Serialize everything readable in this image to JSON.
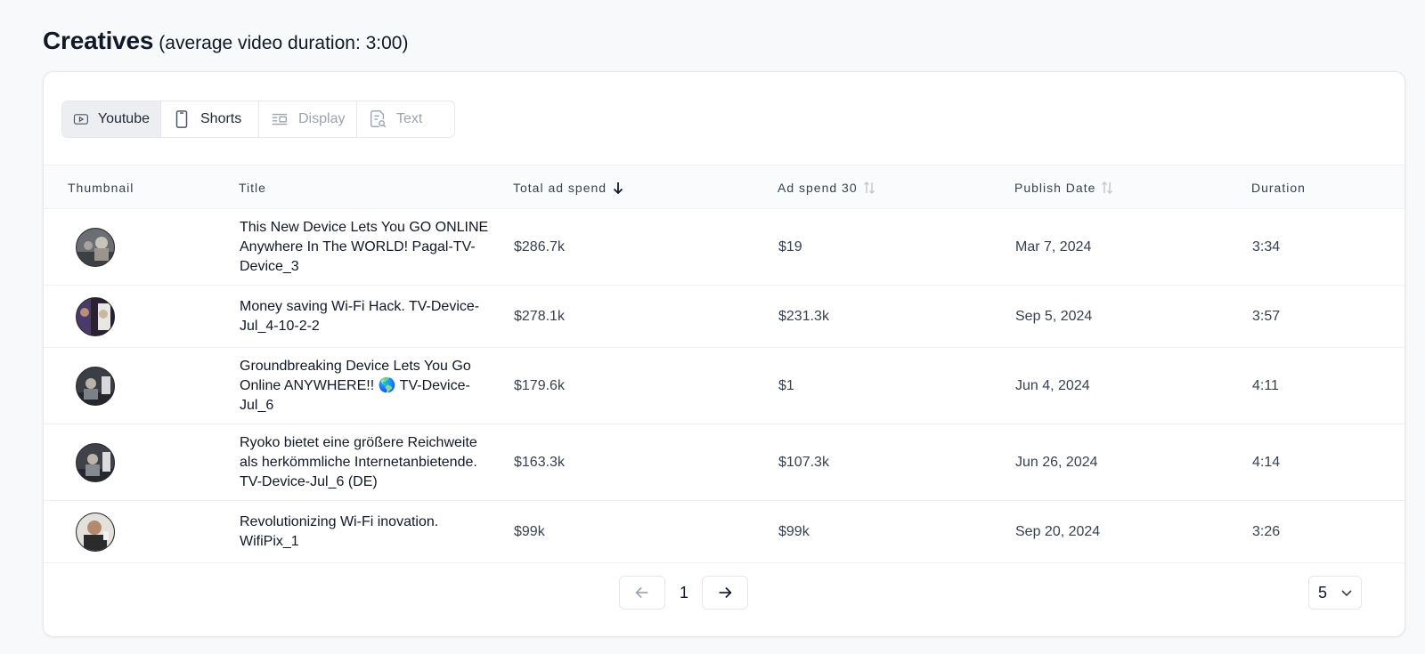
{
  "header": {
    "title": "Creatives",
    "subtitle": "(average video duration: 3:00)"
  },
  "tabs": [
    {
      "label": "Youtube",
      "icon": "youtube-icon",
      "state": "active"
    },
    {
      "label": "Shorts",
      "icon": "phone-icon",
      "state": "enabled"
    },
    {
      "label": "Display",
      "icon": "display-icon",
      "state": "disabled"
    },
    {
      "label": "Text",
      "icon": "text-search-icon",
      "state": "disabled"
    }
  ],
  "table": {
    "columns": {
      "thumbnail": "Thumbnail",
      "title": "Title",
      "total_ad_spend": "Total ad spend",
      "ad_spend_30": "Ad spend 30",
      "publish_date": "Publish Date",
      "duration": "Duration"
    },
    "sort": {
      "column": "total_ad_spend",
      "direction": "desc"
    },
    "rows": [
      {
        "title": "This New Device Lets You GO ONLINE Anywhere In The WORLD! Pagal-TV-Device_3",
        "total_ad_spend": "$286.7k",
        "ad_spend_30": "$19",
        "publish_date": "Mar 7, 2024",
        "duration": "3:34"
      },
      {
        "title": "Money saving Wi-Fi Hack. TV-Device-Jul_4-10-2-2",
        "total_ad_spend": "$278.1k",
        "ad_spend_30": "$231.3k",
        "publish_date": "Sep 5, 2024",
        "duration": "3:57"
      },
      {
        "title": "Groundbreaking Device Lets You Go Online ANYWHERE!! 🌎 TV-Device-Jul_6",
        "total_ad_spend": "$179.6k",
        "ad_spend_30": "$1",
        "publish_date": "Jun 4, 2024",
        "duration": "4:11"
      },
      {
        "title": "Ryoko bietet eine größere Reichweite als herkömmliche Internetanbietende. TV-Device-Jul_6 (DE)",
        "total_ad_spend": "$163.3k",
        "ad_spend_30": "$107.3k",
        "publish_date": "Jun 26, 2024",
        "duration": "4:14"
      },
      {
        "title": "Revolutionizing Wi-Fi inovation. WifiPix_1",
        "total_ad_spend": "$99k",
        "ad_spend_30": "$99k",
        "publish_date": "Sep 20, 2024",
        "duration": "3:26"
      }
    ]
  },
  "pagination": {
    "current_page": "1",
    "page_size": "5"
  },
  "colors": {
    "background": "#f8f9fb",
    "card": "#ffffff",
    "border": "#e5e7eb",
    "active_tab": "#eceef1",
    "disabled_text": "#9ca3af"
  }
}
